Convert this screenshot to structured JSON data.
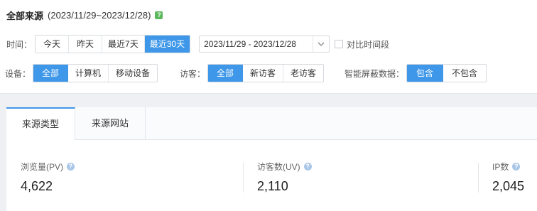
{
  "header": {
    "title": "全部来源",
    "range": "(2023/11/29~2023/12/28)",
    "badge_icon": "?"
  },
  "time_filter": {
    "label": "时间：",
    "options": [
      "今天",
      "昨天",
      "最近7天",
      "最近30天"
    ],
    "active": "最近30天",
    "date_range": "2023/11/29 - 2023/12/28",
    "compare_label": "对比时间段"
  },
  "device_filter": {
    "label": "设备：",
    "options": [
      "全部",
      "计算机",
      "移动设备"
    ],
    "active": "全部"
  },
  "visitor_filter": {
    "label": "访客：",
    "options": [
      "全部",
      "新访客",
      "老访客"
    ],
    "active": "全部"
  },
  "smart_filter": {
    "label": "智能屏蔽数据：",
    "options": [
      "包含",
      "不包含"
    ],
    "active": "包含"
  },
  "tabs": [
    "来源类型",
    "来源网站"
  ],
  "metrics": [
    {
      "label": "浏览量(PV)",
      "value": "4,622"
    },
    {
      "label": "访客数(UV)",
      "value": "2,110"
    },
    {
      "label": "IP数",
      "value": "2,045"
    }
  ],
  "colors": {
    "accent": "#3e97e8",
    "badge_green": "#5cb85c"
  }
}
